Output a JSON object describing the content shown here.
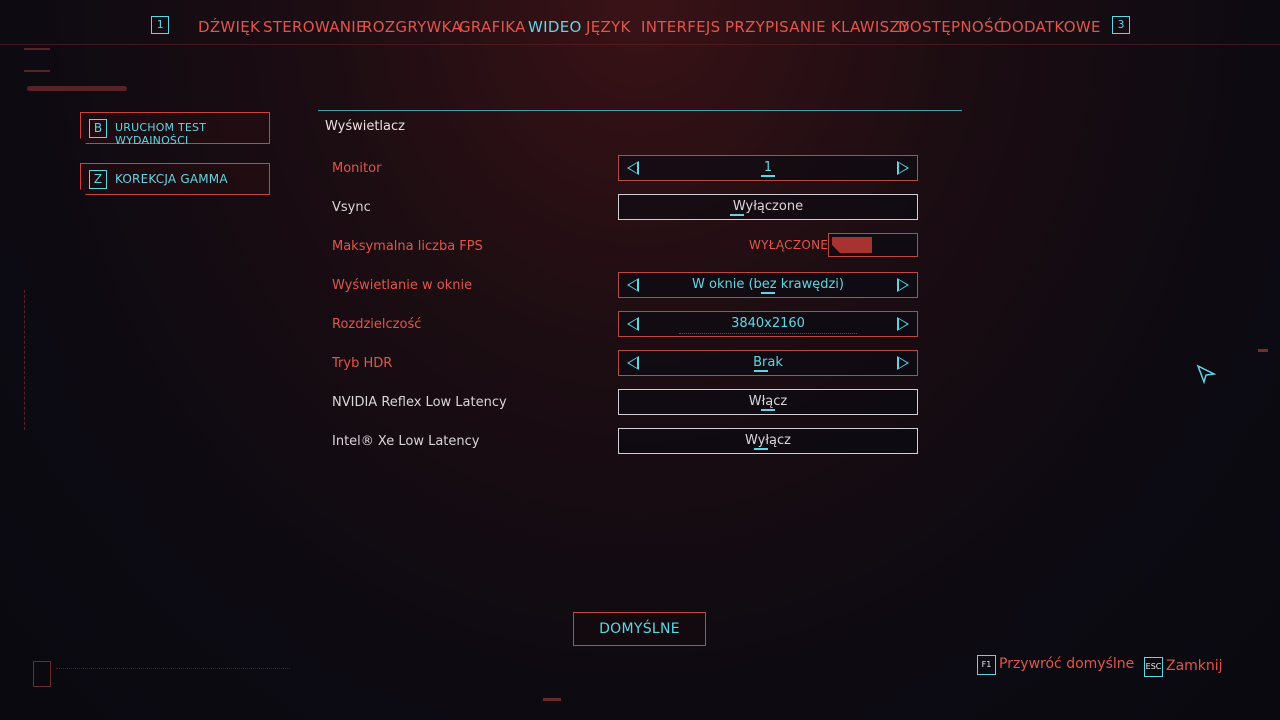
{
  "tabs": {
    "left_key": "1",
    "right_key": "3",
    "items": [
      "DŹWIĘK",
      "STEROWANIE",
      "ROZGRYWKA",
      "GRAFIKA",
      "WIDEO",
      "JĘZYK",
      "INTERFEJS",
      "PRZYPISANIE KLAWISZY",
      "DOSTĘPNOŚĆ",
      "DODATKOWE"
    ],
    "active": "WIDEO"
  },
  "side": {
    "benchmark": {
      "key": "B",
      "label": "URUCHOM TEST WYDAJNOŚCI"
    },
    "gamma": {
      "key": "Z",
      "label": "KOREKCJA GAMMA"
    }
  },
  "section": {
    "title": "Wyświetlacz"
  },
  "settings": [
    {
      "label": "Monitor",
      "value": "1",
      "style": "red",
      "type": "selector"
    },
    {
      "label": "Vsync",
      "value": "Wyłączone",
      "style": "white",
      "type": "button"
    },
    {
      "label": "Maksymalna liczba FPS",
      "value": "WYŁĄCZONE",
      "style": "red",
      "type": "toggle"
    },
    {
      "label": "Wyświetlanie w oknie",
      "value": "W oknie (bez krawędzi)",
      "style": "red",
      "type": "selector"
    },
    {
      "label": "Rozdzielczość",
      "value": "3840x2160",
      "style": "red",
      "type": "selector"
    },
    {
      "label": "Tryb HDR",
      "value": "Brak",
      "style": "red",
      "type": "selector"
    },
    {
      "label": "NVIDIA Reflex Low Latency",
      "value": "Włącz",
      "style": "white",
      "type": "button"
    },
    {
      "label": "Intel® Xe Low Latency",
      "value": "Wyłącz",
      "style": "white",
      "type": "button"
    }
  ],
  "footer": {
    "default_label": "DOMYŚLNE",
    "restore_key": "F1",
    "restore_label": "Przywróć domyślne",
    "close_key": "ESC",
    "close_label": "Zamknij"
  },
  "colors": {
    "accent_red": "#e1554c",
    "accent_cyan": "#5fd6e4",
    "background": "#0d0a12"
  }
}
